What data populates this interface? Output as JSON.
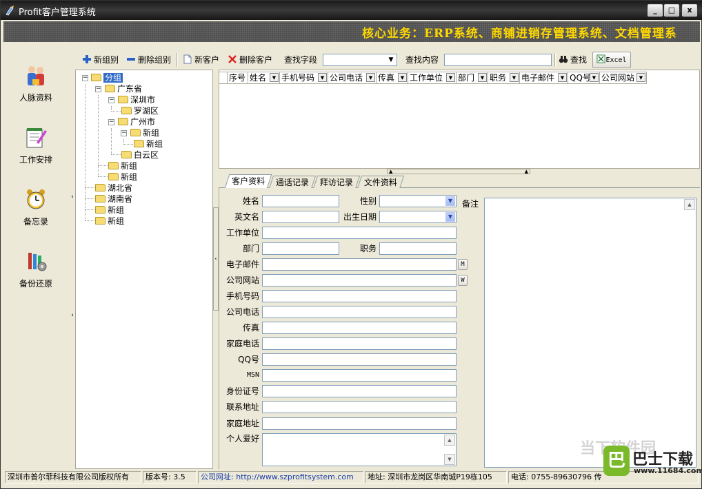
{
  "window": {
    "title": "Profit客户管理系统",
    "minimize_label": "_",
    "maximize_label": "□",
    "close_label": "x"
  },
  "banner": {
    "text": "核心业务：ERP系统、商铺进销存管理系统、文档管理系"
  },
  "nav": {
    "items": [
      {
        "label": "人脉资料",
        "icon": "people-icon"
      },
      {
        "label": "工作安排",
        "icon": "notebook-pen-icon"
      },
      {
        "label": "备忘录",
        "icon": "alarm-clock-icon"
      },
      {
        "label": "备份还原",
        "icon": "tools-icon"
      }
    ],
    "collapse_glyph": "‹"
  },
  "toolbar": {
    "new_group": "新组别",
    "delete_group": "删除组别",
    "new_customer": "新客户",
    "delete_customer": "删除客户",
    "search_field_label": "查找字段",
    "search_field_value": "",
    "search_content_label": "查找内容",
    "search_content_value": "",
    "search_button": "查找",
    "excel_button": "Excel"
  },
  "tree": {
    "root": "分组",
    "nodes": {
      "guangdong": "广东省",
      "shenzhen": "深圳市",
      "luohu": "罗湖区",
      "guangzhou": "广州市",
      "gz_new": "新组",
      "gz_new_sub": "新组",
      "baiyun": "白云区",
      "gd_new1": "新组",
      "gd_new2": "新组",
      "hubei": "湖北省",
      "hunan": "湖南省",
      "root_new1": "新组",
      "root_new2": "新组"
    }
  },
  "grid": {
    "columns": [
      "序号",
      "姓名",
      "手机号码",
      "公司电话",
      "传真",
      "工作单位",
      "部门",
      "职务",
      "电子邮件",
      "QQ号",
      "公司网站"
    ],
    "rows": []
  },
  "tabs": [
    "客户资料",
    "通话记录",
    "拜访记录",
    "文件资料"
  ],
  "form": {
    "name_label": "姓名",
    "gender_label": "性别",
    "english_name_label": "英文名",
    "birthday_label": "出生日期",
    "company_label": "工作单位",
    "department_label": "部门",
    "position_label": "职务",
    "email_label": "电子邮件",
    "email_button": "M",
    "website_label": "公司网站",
    "website_button": "W",
    "mobile_label": "手机号码",
    "company_phone_label": "公司电话",
    "fax_label": "传真",
    "home_phone_label": "家庭电话",
    "qq_label": "QQ号",
    "msn_label": "MSN",
    "id_label": "身份证号",
    "contact_address_label": "联系地址",
    "home_address_label": "家庭地址",
    "hobby_label": "个人爱好",
    "notes_label": "备注"
  },
  "status": {
    "copyright": "深圳市普尔菲科技有限公司版权所有",
    "version": "版本号: 3.5",
    "website": "公司网址: http://www.szprofitsystem.com",
    "address": "地址: 深圳市龙岗区华南城P19栋105",
    "phone": "电话: 0755-89630796 传"
  },
  "watermark": {
    "ghost_text": "当下软件园",
    "logo_text": "巴",
    "brand": "巴士下载",
    "url": "www.11684.com"
  },
  "colors": {
    "banner_text": "#ffd800",
    "selection": "#316ac5",
    "window_face": "#ece9d8"
  }
}
